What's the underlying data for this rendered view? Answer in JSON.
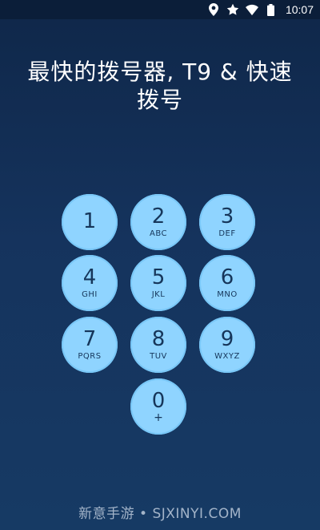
{
  "status_bar": {
    "time": "10:07",
    "icons": [
      "location-icon",
      "star-icon",
      "wifi-icon",
      "battery-icon"
    ]
  },
  "headline": {
    "text": "最快的拨号器, T9 & 快速拨号"
  },
  "keypad": {
    "keys": [
      {
        "digit": "1",
        "letters": ""
      },
      {
        "digit": "2",
        "letters": "ABC"
      },
      {
        "digit": "3",
        "letters": "DEF"
      },
      {
        "digit": "4",
        "letters": "GHI"
      },
      {
        "digit": "5",
        "letters": "JKL"
      },
      {
        "digit": "6",
        "letters": "MNO"
      },
      {
        "digit": "7",
        "letters": "PQRS"
      },
      {
        "digit": "8",
        "letters": "TUV"
      },
      {
        "digit": "9",
        "letters": "WXYZ"
      },
      {
        "digit": "0",
        "letters": "+"
      }
    ]
  },
  "watermark": {
    "text": "新意手游 • SJXINYI.COM"
  },
  "colors": {
    "background_top": "#0f2749",
    "background_bottom": "#163a64",
    "key_fill": "#8fd4ff",
    "key_text": "#16365a"
  }
}
